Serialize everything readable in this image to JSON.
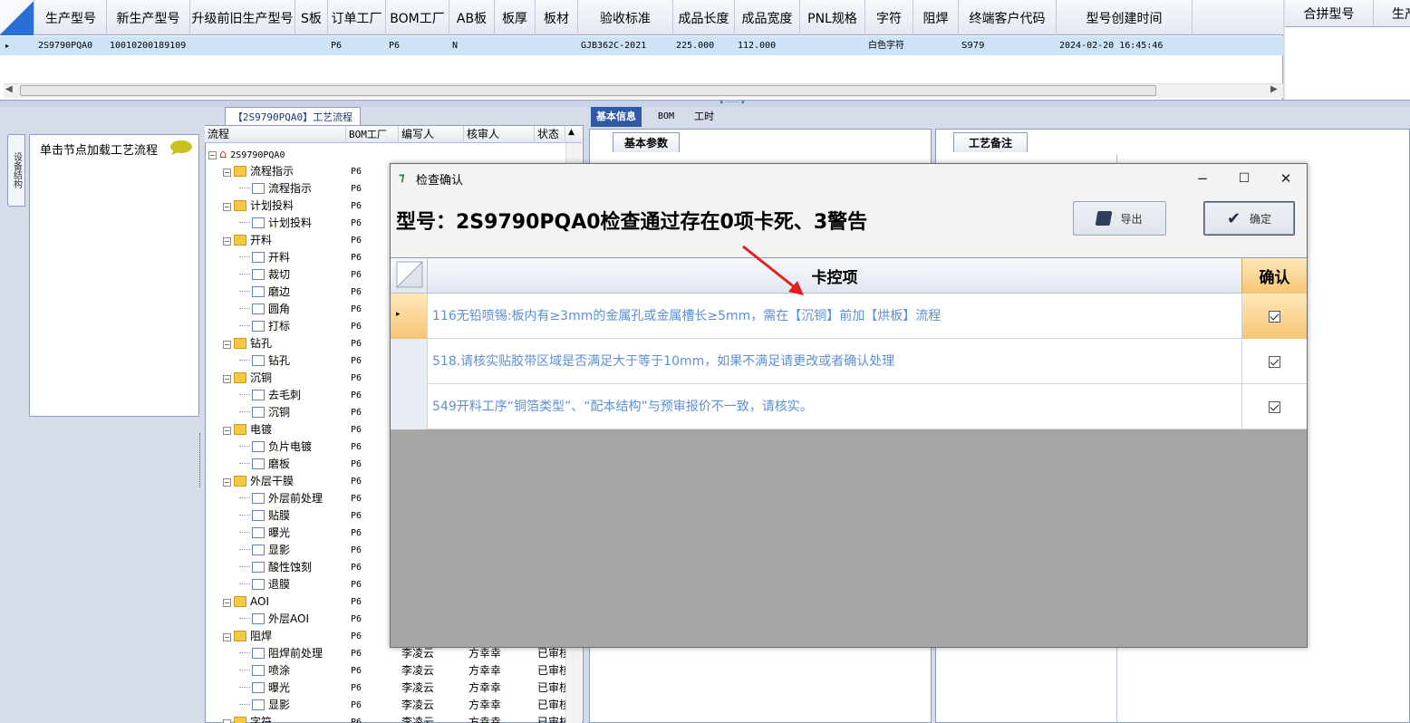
{
  "top_grid": {
    "columns": [
      "生产型号",
      "新生产型号",
      "升级前旧生产型号",
      "S板",
      "订单工厂",
      "BOM工厂",
      "AB板",
      "板厚",
      "板材",
      "验收标准",
      "成品长度",
      "成品宽度",
      "PNL规格",
      "字符",
      "阻焊",
      "终端客户代码",
      "型号创建时间"
    ],
    "row": {
      "生产型号": "2S9790PQA0",
      "新生产型号": "10010200189109",
      "订单工厂": "P6",
      "BOM工厂": "P6",
      "AB板": "N",
      "验收标准": "GJB362C-2021",
      "成品长度": "225.000",
      "成品宽度": "112.000",
      "字符": "白色字符",
      "终端客户代码": "S979",
      "型号创建时间": "2024-02-20 16:45:46"
    },
    "row_indicator": "▸"
  },
  "merge_grid": {
    "columns": [
      "合拼型号",
      "生产"
    ]
  },
  "left_panel": {
    "vertical_tab": "设备结构",
    "node_tip": "单击节点加载工艺流程"
  },
  "tree": {
    "tab_title": "【2S9790PQA0】工艺流程",
    "columns": [
      "流程",
      "BOM工厂",
      "编写人",
      "核审人",
      "状态"
    ],
    "root": "2S9790PQA0",
    "rows": [
      {
        "name": "流程指示",
        "type": "folder",
        "factory": "P6"
      },
      {
        "name": "流程指示",
        "type": "doc",
        "factory": "P6"
      },
      {
        "name": "计划投料",
        "type": "folder",
        "factory": "P6"
      },
      {
        "name": "计划投料",
        "type": "doc",
        "factory": "P6"
      },
      {
        "name": "开料",
        "type": "folder",
        "factory": "P6"
      },
      {
        "name": "开料",
        "type": "doc",
        "factory": "P6"
      },
      {
        "name": "裁切",
        "type": "doc",
        "factory": "P6"
      },
      {
        "name": "磨边",
        "type": "doc",
        "factory": "P6"
      },
      {
        "name": "圆角",
        "type": "doc",
        "factory": "P6"
      },
      {
        "name": "打标",
        "type": "doc",
        "factory": "P6"
      },
      {
        "name": "钻孔",
        "type": "folder",
        "factory": "P6"
      },
      {
        "name": "钻孔",
        "type": "doc",
        "factory": "P6"
      },
      {
        "name": "沉铜",
        "type": "folder",
        "factory": "P6"
      },
      {
        "name": "去毛刺",
        "type": "doc",
        "factory": "P6"
      },
      {
        "name": "沉铜",
        "type": "doc",
        "factory": "P6"
      },
      {
        "name": "电镀",
        "type": "folder",
        "factory": "P6"
      },
      {
        "name": "负片电镀",
        "type": "doc",
        "factory": "P6"
      },
      {
        "name": "磨板",
        "type": "doc",
        "factory": "P6"
      },
      {
        "name": "外层干膜",
        "type": "folder",
        "factory": "P6"
      },
      {
        "name": "外层前处理",
        "type": "doc",
        "factory": "P6"
      },
      {
        "name": "贴膜",
        "type": "doc",
        "factory": "P6"
      },
      {
        "name": "曝光",
        "type": "doc",
        "factory": "P6"
      },
      {
        "name": "显影",
        "type": "doc",
        "factory": "P6"
      },
      {
        "name": "酸性蚀刻",
        "type": "doc",
        "factory": "P6"
      },
      {
        "name": "退膜",
        "type": "doc",
        "factory": "P6"
      },
      {
        "name": "AOI",
        "type": "folder",
        "factory": "P6"
      },
      {
        "name": "外层AOI",
        "type": "doc",
        "factory": "P6"
      },
      {
        "name": "阻焊",
        "type": "folder",
        "factory": "P6"
      },
      {
        "name": "阻焊前处理",
        "type": "doc",
        "factory": "P6",
        "writer": "李凌云",
        "reviewer": "方幸幸",
        "status": "已审核"
      },
      {
        "name": "喷涂",
        "type": "doc",
        "factory": "P6",
        "writer": "李凌云",
        "reviewer": "方幸幸",
        "status": "已审核"
      },
      {
        "name": "曝光",
        "type": "doc",
        "factory": "P6",
        "writer": "李凌云",
        "reviewer": "方幸幸",
        "status": "已审核"
      },
      {
        "name": "显影",
        "type": "doc",
        "factory": "P6",
        "writer": "李凌云",
        "reviewer": "方幸幸",
        "status": "已审核"
      },
      {
        "name": "字符",
        "type": "folder",
        "factory": "P6",
        "writer": "李凌云",
        "reviewer": "方幸幸",
        "status": "已审核"
      }
    ]
  },
  "right_tabs": {
    "tabs": [
      "基本信息",
      "BOM",
      "工时"
    ]
  },
  "basic_params_tab": "基本参数",
  "process_note_tab": "工艺备注",
  "dialog": {
    "title": "检查确认",
    "heading": "型号：2S9790PQA0检查通过存在0项卡死、3警告",
    "export_label": "导出",
    "confirm_label": "确定",
    "col_check": "卡控项",
    "col_confirm": "确认",
    "items": [
      "116无铅喷锡:板内有≥3mm的金属孔或金属槽长≥5mm，需在【沉铜】前加【烘板】流程",
      "518.请核实贴胶带区域是否满足大于等于10mm，如果不满足请更改或者确认处理",
      "549开料工序“铜箔类型”、“配本结构”与预审报价不一致，请核实。"
    ],
    "minimize": "−",
    "maximize": "☐",
    "close": "✕"
  },
  "colors": {
    "selection": "#cde3f7",
    "accent": "#2c5aa8",
    "link_text": "#5b8fd6",
    "arrow": "#e02020"
  }
}
